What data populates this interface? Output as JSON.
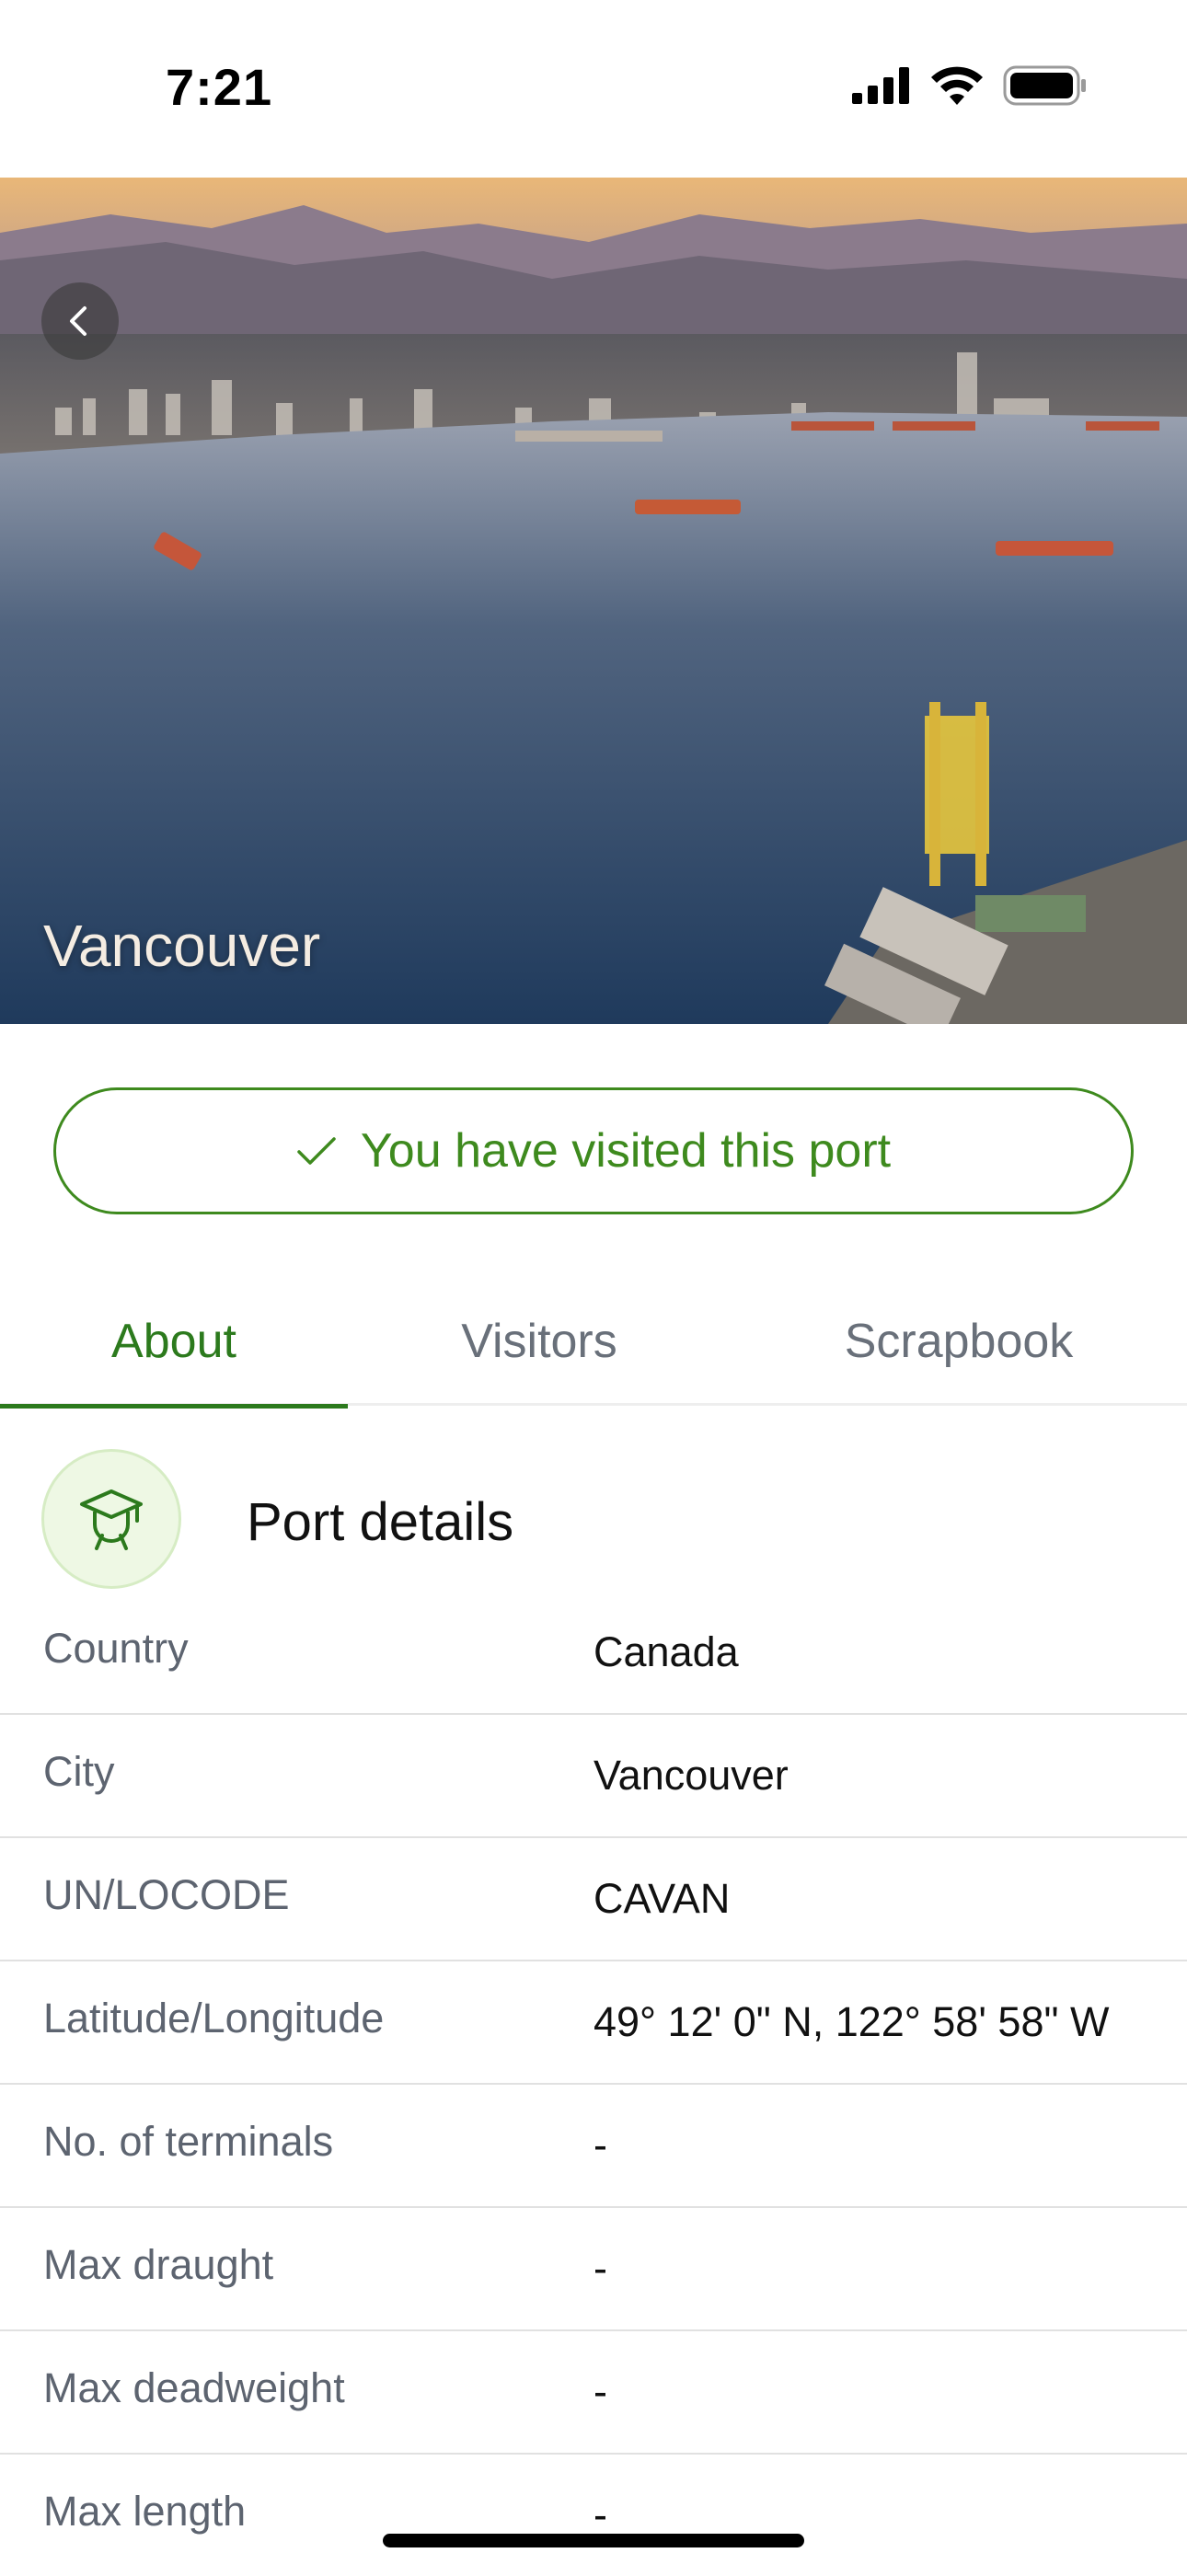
{
  "status_bar": {
    "time": "7:21",
    "icons": [
      "cellular-signal-icon",
      "wifi-icon",
      "battery-icon"
    ]
  },
  "hero": {
    "title": "Vancouver",
    "back_icon": "chevron-left-icon"
  },
  "visited_banner": {
    "icon": "checkmark-icon",
    "label": "You have visited this port",
    "color": "#3e8a1e"
  },
  "tabs": [
    {
      "label": "About",
      "active": true
    },
    {
      "label": "Visitors",
      "active": false
    },
    {
      "label": "Scrapbook",
      "active": false
    }
  ],
  "section": {
    "icon": "graduate-icon",
    "title": "Port details"
  },
  "details": [
    {
      "label": "Country",
      "value": "Canada"
    },
    {
      "label": "City",
      "value": "Vancouver"
    },
    {
      "label": "UN/LOCODE",
      "value": "CAVAN"
    },
    {
      "label": "Latitude/Longitude",
      "value": "49° 12' 0\" N, 122° 58' 58\" W"
    },
    {
      "label": "No. of terminals",
      "value": "-"
    },
    {
      "label": "Max draught",
      "value": "-"
    },
    {
      "label": "Max deadweight",
      "value": "-"
    },
    {
      "label": "Max length",
      "value": "-"
    }
  ],
  "colors": {
    "accent_green": "#2c7a1d",
    "muted_text": "#5d6470"
  }
}
